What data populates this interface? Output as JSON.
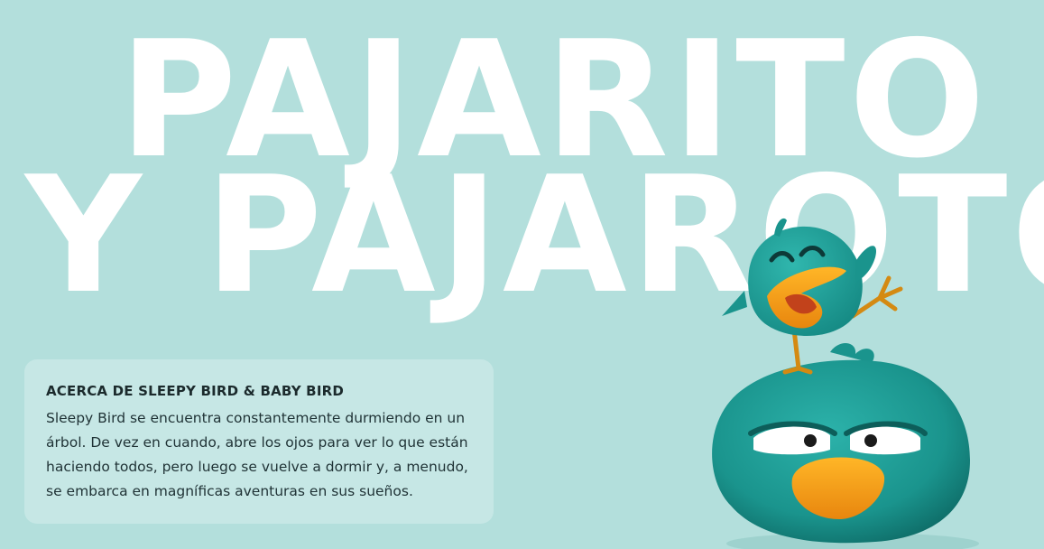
{
  "hero": {
    "title_line_1": "PAJARITO",
    "title_line_2": "Y PAJAROTO"
  },
  "about": {
    "heading": "ACERCA DE SLEEPY BIRD & BABY BIRD",
    "body": "Sleepy Bird se encuentra constantemente durmiendo en un árbol. De vez en cuando, abre los ojos para ver lo que están haciendo todos, pero luego se vuelve a dormir y, a menudo, se embarca en magníficas aventuras en sus sueños."
  },
  "colors": {
    "background": "#b3dfdc",
    "title": "#ffffff",
    "card": "#c6e7e5",
    "bird_body": "#1f9c95",
    "beak": "#f4a219"
  }
}
